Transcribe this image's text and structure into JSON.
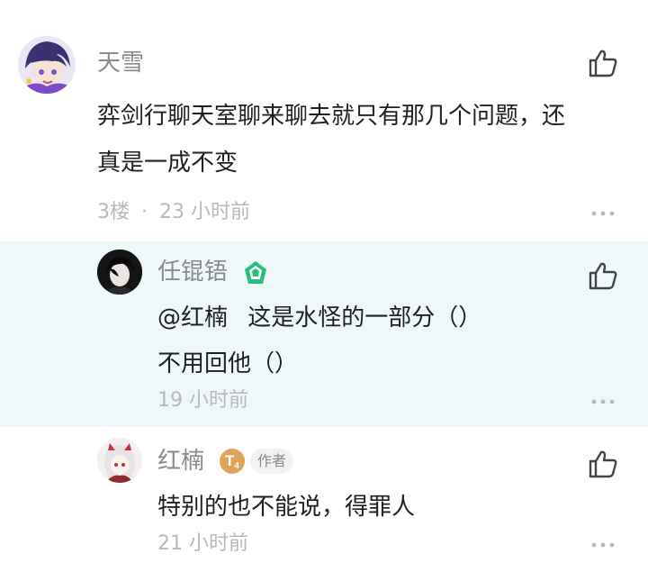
{
  "comments": [
    {
      "username": "天雪",
      "text_lines": [
        "弈剑行聊天室聊来聊去就只有那几个问题，还",
        "真是一成不变"
      ],
      "floor": "3楼",
      "separator": "·",
      "time": "23 小时前"
    },
    {
      "username": "任锟铻",
      "mention": "@红楠",
      "text_lines": [
        "这是水怪的一部分（）",
        "不用回他（）"
      ],
      "time": "19 小时前"
    },
    {
      "username": "红楠",
      "level_badge": "T",
      "level_sub": "4",
      "author_tag": "作者",
      "text_lines": [
        "特别的也不能说，得罪人"
      ],
      "time": "21 小时前"
    }
  ],
  "colors": {
    "reply_highlight": "#eef8fb",
    "verified_badge": "#26c07a",
    "level_badge": "#e0a35c",
    "author_tag_bg": "#f2f2f2",
    "username": "#8a8a8a",
    "body_text": "#1f1f1f",
    "meta_text": "#b8b8b8"
  },
  "icons": [
    "avatar",
    "thumbs-up-icon",
    "more-icon",
    "verified-badge-icon",
    "level-badge"
  ]
}
